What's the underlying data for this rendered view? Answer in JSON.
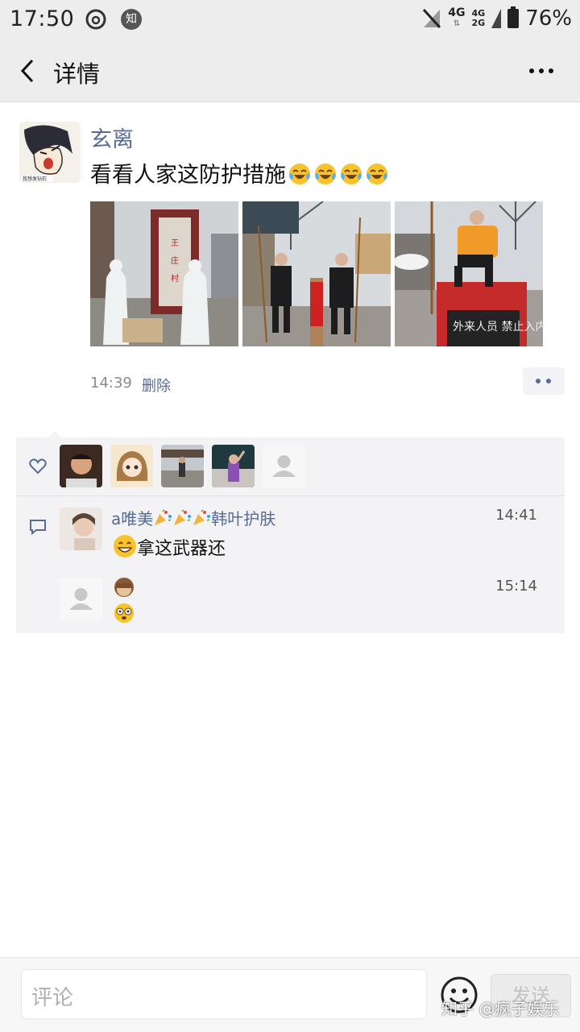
{
  "status_bar": {
    "time": "17:50",
    "app_badge": "知",
    "net1": "4G",
    "net2a": "4G",
    "net2b": "2G",
    "battery": "76%"
  },
  "nav": {
    "title": "详情"
  },
  "post": {
    "username": "玄离",
    "text": "看看人家这防护措施",
    "emoji_count": 4,
    "photo_sign_1": "王庄村",
    "photo_sign_3": "外来人员 禁止入内",
    "time": "14:39",
    "delete_label": "删除"
  },
  "comments": [
    {
      "name": "a唯美",
      "name_suffix": "韩叶护肤",
      "time": "14:41",
      "text": "拿这武器还"
    },
    {
      "time": "15:14"
    }
  ],
  "input": {
    "placeholder": "评论",
    "send_label": "发送"
  },
  "watermark": "知乎 @疯子娱乐",
  "colors": {
    "link": "#576b95",
    "bar": "#ededed",
    "panel": "#f3f3f5"
  }
}
